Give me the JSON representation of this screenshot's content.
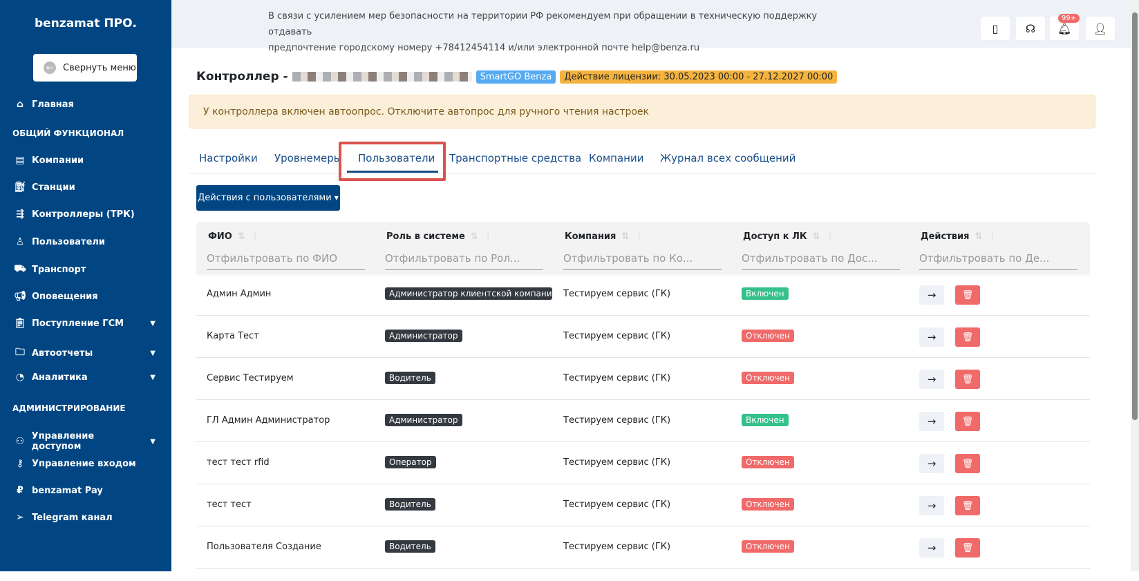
{
  "sidebar": {
    "logo": "benzamat ПРО.",
    "collapse": "Свернуть меню",
    "items": [
      {
        "label": "Главная"
      },
      {
        "label": "Компании"
      },
      {
        "label": "Станции"
      },
      {
        "label": "Контроллеры (ТРК)"
      },
      {
        "label": "Пользователи"
      },
      {
        "label": "Транспорт"
      },
      {
        "label": "Оповещения"
      },
      {
        "label": "Поступление ГСМ"
      },
      {
        "label": "Автоотчеты"
      },
      {
        "label": "Аналитика"
      },
      {
        "label": "Управление доступом"
      },
      {
        "label": "Управление входом"
      },
      {
        "label": "benzamat Pay"
      },
      {
        "label": "Telegram канал"
      }
    ],
    "sections": [
      "ОБЩИЙ ФУНКЦИОНАЛ",
      "АДМИНИСТРИРОВАНИЕ"
    ]
  },
  "header": {
    "notice_line1": "В связи с усилением мер безопасности на территории РФ рекомендуем при обращении в техническую поддержку отдавать",
    "notice_line2": "предпочтение городскому номеру +78412454114 и/или электронной почте help@benza.ru",
    "badge": "99+"
  },
  "page": {
    "title": "Контроллер -",
    "tag": "SmartGO Benza",
    "license": "Действие лицензии: 30.05.2023 00:00 - 27.12.2027 00:00",
    "alert": "У контроллера включен автоопрос. Отключите автопрос для ручного чтения настроек",
    "tabs": [
      "Настройки",
      "Уровнемеры",
      "Пользователи",
      "Транспортные средства",
      "Компании",
      "Журнал всех сообщений"
    ],
    "actions_button": "Действия с пользователями"
  },
  "table": {
    "columns": [
      {
        "label": "ФИО",
        "filter": "Отфильтровать по ФИО"
      },
      {
        "label": "Роль в системе",
        "filter": "Отфильтровать по Рол..."
      },
      {
        "label": "Компания",
        "filter": "Отфильтровать по Ко..."
      },
      {
        "label": "Доступ к ЛК",
        "filter": "Отфильтровать по Дос..."
      },
      {
        "label": "Действия",
        "filter": "Отфильтровать по Де..."
      }
    ],
    "rows": [
      {
        "name": "Админ Админ",
        "role": "Администратор клиентской компании",
        "company": "Тестируем сервис (ГК)",
        "access": "Включен",
        "on": true
      },
      {
        "name": "Карта Тест",
        "role": "Администратор",
        "company": "Тестируем сервис (ГК)",
        "access": "Отключен",
        "on": false
      },
      {
        "name": "Сервис Тестируем",
        "role": "Водитель",
        "company": "Тестируем сервис (ГК)",
        "access": "Отключен",
        "on": false
      },
      {
        "name": "ГЛ Админ Администратор",
        "role": "Администратор",
        "company": "Тестируем сервис (ГК)",
        "access": "Включен",
        "on": true
      },
      {
        "name": "тест тест rfid",
        "role": "Оператор",
        "company": "Тестируем сервис (ГК)",
        "access": "Отключен",
        "on": false
      },
      {
        "name": "тест тест",
        "role": "Водитель",
        "company": "Тестируем сервис (ГК)",
        "access": "Отключен",
        "on": false
      },
      {
        "name": "Пользователя Создание",
        "role": "Водитель",
        "company": "Тестируем сервис (ГК)",
        "access": "Отключен",
        "on": false
      }
    ]
  },
  "colors": {
    "sidebar": "#014682",
    "on": "#35c18b",
    "off": "#f06a6a"
  }
}
